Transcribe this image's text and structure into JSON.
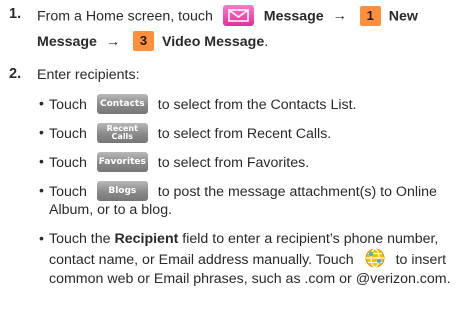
{
  "step1": {
    "num": "1.",
    "prefix": "From a Home screen, touch",
    "message": "Message",
    "arrow": "→",
    "key1": "1",
    "new_message": "New Message",
    "arrow2": "→",
    "key3": "3",
    "video_message": "Video Message",
    "period": "."
  },
  "step2": {
    "num": "2.",
    "text": "Enter recipients:"
  },
  "bullets": {
    "b1": {
      "touch": "Touch",
      "key": "Contacts",
      "rest": "to select from the Contacts List."
    },
    "b2": {
      "touch": "Touch",
      "key_l1": "Recent",
      "key_l2": "Calls",
      "rest": "to select from Recent Calls."
    },
    "b3": {
      "touch": "Touch",
      "key": "Favorites",
      "rest": "to select from Favorites."
    },
    "b4": {
      "touch": "Touch",
      "key": "Blogs",
      "rest": "to post  the message attachment(s) to Online",
      "line2": "Album, or to a blog."
    },
    "b5": {
      "l1a": "Touch the",
      "l1b": "Recipient",
      "l1c": "field to enter a recipient’s phone number,",
      "l2a": "contact name, or Email address manually. Touch",
      "l2b": "to insert",
      "l3": "common web or Email phrases, such as .com or @verizon.com."
    }
  },
  "colors": {
    "text": "#2a2a2a",
    "numkey": "#ff8f3a",
    "envelope": "#e0309b",
    "softkey": "#8a8a8a"
  }
}
